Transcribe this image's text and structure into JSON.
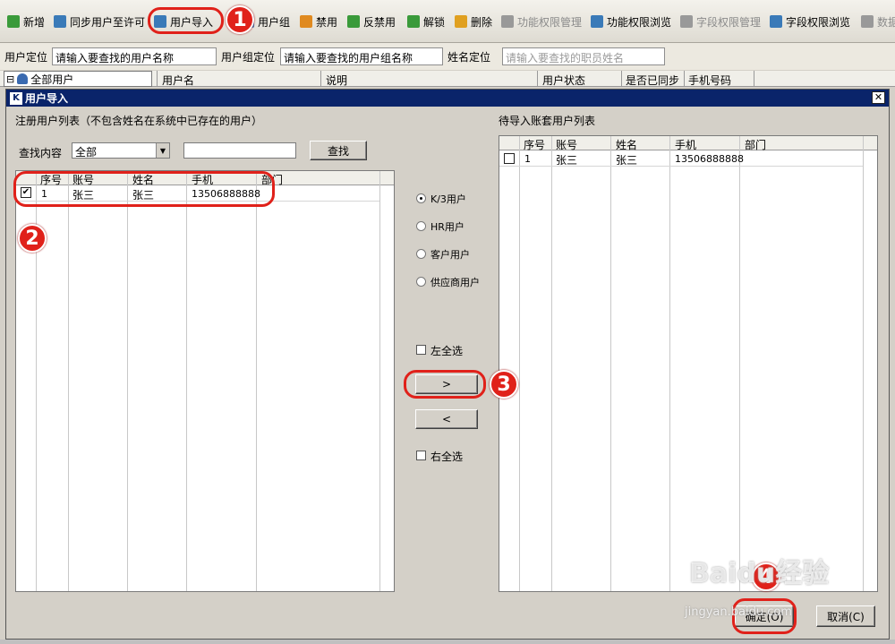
{
  "toolbar": {
    "items": [
      {
        "label": "新增",
        "icon": "add-icon",
        "color": "#3a9a3a",
        "disabled": false
      },
      {
        "label": "同步用户至许可",
        "icon": "sync-icon",
        "color": "#3a7ab8",
        "disabled": false
      },
      {
        "label": "用户导入",
        "icon": "import-icon",
        "color": "#3a7ab8",
        "disabled": false
      },
      {
        "label": "用户组",
        "icon": "user-group-icon",
        "color": "#3a7ab8",
        "disabled": false
      },
      {
        "label": "禁用",
        "icon": "disable-icon",
        "color": "#e08a20",
        "disabled": false
      },
      {
        "label": "反禁用",
        "icon": "enable-icon",
        "color": "#3a9a3a",
        "disabled": false
      },
      {
        "label": "解锁",
        "icon": "unlock-icon",
        "color": "#3a9a3a",
        "disabled": false
      },
      {
        "label": "删除",
        "icon": "delete-icon",
        "color": "#e0a020",
        "disabled": false
      },
      {
        "label": "功能权限管理",
        "icon": "function-permission-icon",
        "color": "#999999",
        "disabled": true
      },
      {
        "label": "功能权限浏览",
        "icon": "function-browse-icon",
        "color": "#3a7ab8",
        "disabled": false
      },
      {
        "label": "字段权限管理",
        "icon": "field-permission-icon",
        "color": "#999999",
        "disabled": true
      },
      {
        "label": "字段权限浏览",
        "icon": "field-browse-icon",
        "color": "#3a7ab8",
        "disabled": false
      },
      {
        "label": "数据",
        "icon": "data-icon",
        "color": "#999999",
        "disabled": true
      }
    ]
  },
  "locate": {
    "user_label": "用户定位",
    "user_placeholder": "请输入要查找的用户名称",
    "group_label": "用户组定位",
    "group_value": "请输入要查找的用户组名称",
    "name_label": "姓名定位",
    "name_placeholder": "请输入要查找的职员姓名"
  },
  "main_grid": {
    "tree_root": "全部用户",
    "tree_toggle": "⊟",
    "headers": [
      "用户名",
      "说明",
      "用户状态",
      "是否已同步",
      "手机号码"
    ]
  },
  "dialog": {
    "title": "用户导入",
    "app_icon": "K",
    "close": "✕",
    "left_title": "注册用户列表（不包含姓名在系统中已存在的用户）",
    "search_label": "查找内容",
    "search_select": "全部",
    "search_input": "",
    "search_button": "查找",
    "left_grid": {
      "headers": [
        "序号",
        "账号",
        "姓名",
        "手机",
        "部门"
      ],
      "rows": [
        {
          "seq": "1",
          "account": "张三",
          "name": "张三",
          "phone": "13506888888",
          "dept": "",
          "checked": true
        }
      ]
    },
    "radios": [
      {
        "label": "K/3用户",
        "checked": true
      },
      {
        "label": "HR用户",
        "checked": false
      },
      {
        "label": "客户用户",
        "checked": false
      },
      {
        "label": "供应商用户",
        "checked": false
      }
    ],
    "left_select_all": "左全选",
    "move_right": ">",
    "move_left": "<",
    "right_select_all": "右全选",
    "right_title": "待导入账套用户列表",
    "right_grid": {
      "headers": [
        "序号",
        "账号",
        "姓名",
        "手机",
        "部门"
      ],
      "rows": [
        {
          "seq": "1",
          "account": "张三",
          "name": "张三",
          "phone": "13506888888",
          "dept": "",
          "checked": false
        }
      ]
    },
    "ok_button": "确定(O)",
    "cancel_button": "取消(C)"
  },
  "annotations": [
    "1",
    "2",
    "3",
    "4"
  ],
  "watermark": {
    "brand": "Baidu经验",
    "url": "jingyan.baidu.com"
  }
}
